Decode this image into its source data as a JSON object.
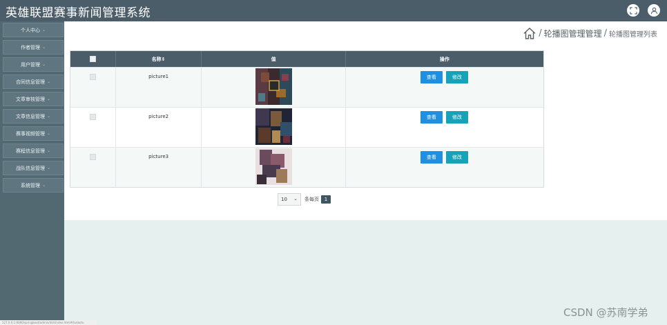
{
  "app": {
    "title": "英雄联盟赛事新闻管理系统"
  },
  "header_icons": [
    "fullscreen-icon",
    "user-icon"
  ],
  "sidebar": {
    "items": [
      {
        "label": "个人中心"
      },
      {
        "label": "作者管理"
      },
      {
        "label": "用户管理"
      },
      {
        "label": "合同信息管理"
      },
      {
        "label": "文章审核管理"
      },
      {
        "label": "文章信息管理"
      },
      {
        "label": "赛事视频管理"
      },
      {
        "label": "赛程信息管理"
      },
      {
        "label": "战队信息管理"
      },
      {
        "label": "系统管理"
      }
    ]
  },
  "breadcrumb": {
    "level1": "轮播图管理管理",
    "level2": "轮播图管理列表",
    "separator": "/"
  },
  "table": {
    "headers": [
      "",
      "名称⇕",
      "值",
      "操作"
    ],
    "rows": [
      {
        "name": "picture1",
        "view": "查看",
        "edit": "修改"
      },
      {
        "name": "picture2",
        "view": "查看",
        "edit": "修改"
      },
      {
        "name": "picture3",
        "view": "查看",
        "edit": "修改"
      }
    ]
  },
  "pagination": {
    "page_size": "10",
    "label": "条每页",
    "current_page": "1"
  },
  "watermark": "CSDN @苏南学弟",
  "status_url": "127.0.0.1:8080/springboot/admin/dist/index.html#/lunbotu",
  "colors": {
    "header": "#4b5d68",
    "sidebar": "#536972",
    "view_button": "#1e8fe1",
    "edit_button": "#17a2b8"
  }
}
